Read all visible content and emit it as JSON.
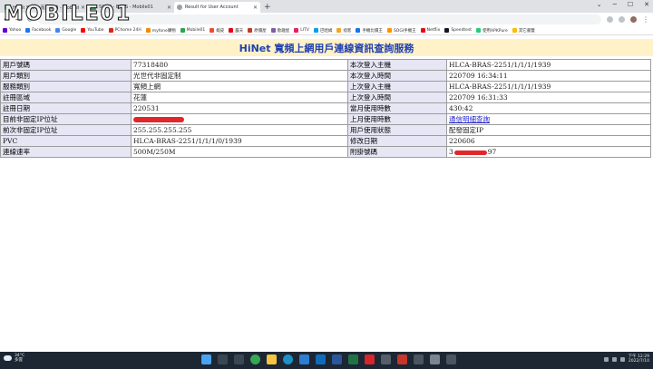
{
  "watermark": "MOBILE01",
  "tabs": [
    {
      "title": "Hinet 500M 而速開箱 - Mobile01",
      "active": false
    },
    {
      "title": "500M - BRAS - Mobile01",
      "active": false
    },
    {
      "title": "Result for User Account",
      "active": true
    }
  ],
  "bookmarks": [
    {
      "label": "Yahoo",
      "color": "#6001d2"
    },
    {
      "label": "Facebook",
      "color": "#1877f2"
    },
    {
      "label": "Google",
      "color": "#4285f4"
    },
    {
      "label": "YouTube",
      "color": "#ff0000"
    },
    {
      "label": "PChome 24H",
      "color": "#d9261c"
    },
    {
      "label": "myfone購物",
      "color": "#f08c00"
    },
    {
      "label": "Mobile01",
      "color": "#2da44e"
    },
    {
      "label": "蝦皮",
      "color": "#ee4d2d"
    },
    {
      "label": "露天",
      "color": "#e60012"
    },
    {
      "label": "原價屋",
      "color": "#c0392b"
    },
    {
      "label": "歐趣屋",
      "color": "#7b5ea7"
    },
    {
      "label": "LITV",
      "color": "#e91e63"
    },
    {
      "label": "巴哈姆",
      "color": "#00a0e9"
    },
    {
      "label": "痞客",
      "color": "#f5a623"
    },
    {
      "label": "手機比價王",
      "color": "#1a73e8"
    },
    {
      "label": "SOGI手機王",
      "color": "#ff8f00"
    },
    {
      "label": "Netflix",
      "color": "#e50914"
    },
    {
      "label": "Speedtest",
      "color": "#141526"
    },
    {
      "label": "使用APKPure",
      "color": "#24cd77"
    },
    {
      "label": "其它書籤",
      "color": "#fbbc04"
    }
  ],
  "page": {
    "title": "HiNet 寬頻上網用戶連線資訊查詢服務"
  },
  "rows": [
    {
      "l1": "用戶號碼",
      "v1": "77318480",
      "l2": "本次登入主機",
      "v2": "HLCA-BRAS-2251/1/1/1/1939"
    },
    {
      "l1": "用戶類別",
      "v1": "光世代非固定制",
      "l2": "本次登入時間",
      "v2": "220709 16:34:11"
    },
    {
      "l1": "服務類別",
      "v1": "寬頻上網",
      "l2": "上次登入主機",
      "v2": "HLCA-BRAS-2251/1/1/1/1939"
    },
    {
      "l1": "註冊區域",
      "v1": "花蓮",
      "l2": "上次登入時間",
      "v2": "220709 16:31:33"
    },
    {
      "l1": "註冊日期",
      "v1": "220531",
      "l2": "當月使用時數",
      "v2": "430:42"
    },
    {
      "l1": "目前非固定IP位址",
      "v1": "",
      "l2": "上月使用時數",
      "v2": "通信明細查詢"
    },
    {
      "l1": "前次非固定IP位址",
      "v1": "255.255.255.255",
      "l2": "用戶使用狀態",
      "v2": "配發固定IP"
    },
    {
      "l1": "PVC",
      "v1": "HLCA-BRAS-2251/1/1/1/0/1939",
      "l2": "修改日期",
      "v2": "220606"
    },
    {
      "l1": "連線速率",
      "v1": "500M/250M",
      "l2": "附掛號碼",
      "v2_pre": "3",
      "v2_post": "97"
    }
  ],
  "taskbar": {
    "temp": "34°C",
    "weather": "多雲",
    "time": "下午 12:29",
    "date": "2022/7/10"
  }
}
